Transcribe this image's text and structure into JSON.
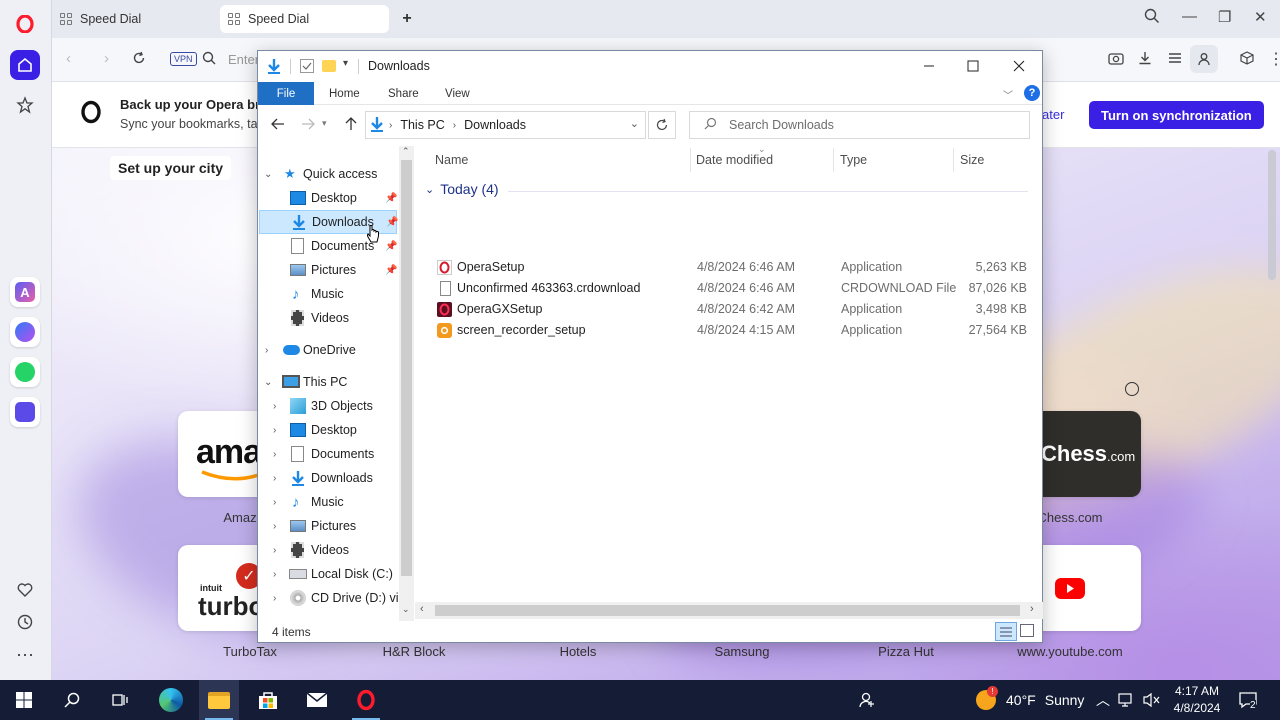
{
  "browser": {
    "tabs": [
      {
        "label": "Speed Dial",
        "active": false
      },
      {
        "label": "Speed Dial",
        "active": true
      }
    ],
    "address_placeholder": "Enter",
    "vpn_label": "VPN",
    "sync_banner": {
      "title": "Back up your Opera bro",
      "subtitle": "Sync your bookmarks, tab",
      "later_label": "ater",
      "sync_button": "Turn on synchronization"
    },
    "city_label": "Set up your city",
    "speed_dial": {
      "row1": [
        {
          "label": "Amaz",
          "logo_text": "ama"
        },
        {
          "label": "Chess.com",
          "logo_text": "Chess",
          "logo_suffix": ".com"
        }
      ],
      "row2": [
        {
          "label": "TurboTax",
          "logo_text": "turbo",
          "logo_top": "intuit"
        },
        {
          "label": "H&R Block"
        },
        {
          "label": "Hotels"
        },
        {
          "label": "Samsung"
        },
        {
          "label": "Pizza Hut"
        },
        {
          "label": "www.youtube.com"
        }
      ]
    },
    "accent_color": "#3a1fe4"
  },
  "explorer": {
    "title": "Downloads",
    "ribbon_tabs": [
      "File",
      "Home",
      "Share",
      "View"
    ],
    "breadcrumb": [
      "This PC",
      "Downloads"
    ],
    "search_placeholder": "Search Downloads",
    "columns": [
      "Name",
      "Date modified",
      "Type",
      "Size"
    ],
    "group_label": "Today (4)",
    "files": [
      {
        "name": "OperaSetup",
        "date": "4/8/2024 6:46 AM",
        "type": "Application",
        "size": "5,263 KB",
        "icon": "opera-setup-icon"
      },
      {
        "name": "Unconfirmed 463363.crdownload",
        "date": "4/8/2024 6:46 AM",
        "type": "CRDOWNLOAD File",
        "size": "87,026 KB",
        "icon": "blank-file-icon"
      },
      {
        "name": "OperaGXSetup",
        "date": "4/8/2024 6:42 AM",
        "type": "Application",
        "size": "3,498 KB",
        "icon": "opera-gx-icon"
      },
      {
        "name": "screen_recorder_setup",
        "date": "4/8/2024 4:15 AM",
        "type": "Application",
        "size": "27,564 KB",
        "icon": "recorder-icon"
      }
    ],
    "nav": {
      "quick_access": "Quick access",
      "quick_items": [
        {
          "label": "Desktop",
          "icon": "desktop-icon",
          "pinned": true
        },
        {
          "label": "Downloads",
          "icon": "downloads-icon",
          "pinned": true,
          "selected": true
        },
        {
          "label": "Documents",
          "icon": "documents-icon",
          "pinned": true
        },
        {
          "label": "Pictures",
          "icon": "pictures-icon",
          "pinned": true
        },
        {
          "label": "Music",
          "icon": "music-icon",
          "pinned": false
        },
        {
          "label": "Videos",
          "icon": "videos-icon",
          "pinned": false
        }
      ],
      "onedrive": "OneDrive",
      "this_pc": "This PC",
      "pc_items": [
        {
          "label": "3D Objects",
          "icon": "3d-objects-icon"
        },
        {
          "label": "Desktop",
          "icon": "desktop-icon"
        },
        {
          "label": "Documents",
          "icon": "documents-icon"
        },
        {
          "label": "Downloads",
          "icon": "downloads-icon"
        },
        {
          "label": "Music",
          "icon": "music-icon"
        },
        {
          "label": "Pictures",
          "icon": "pictures-icon"
        },
        {
          "label": "Videos",
          "icon": "videos-icon"
        },
        {
          "label": "Local Disk (C:)",
          "icon": "drive-icon"
        },
        {
          "label": "CD Drive (D:) virt",
          "icon": "cd-drive-icon"
        }
      ]
    },
    "status": "4 items"
  },
  "taskbar": {
    "weather_temp": "40°F",
    "weather_text": "Sunny",
    "time": "4:17 AM",
    "date": "4/8/2024",
    "notification_count": "2"
  }
}
